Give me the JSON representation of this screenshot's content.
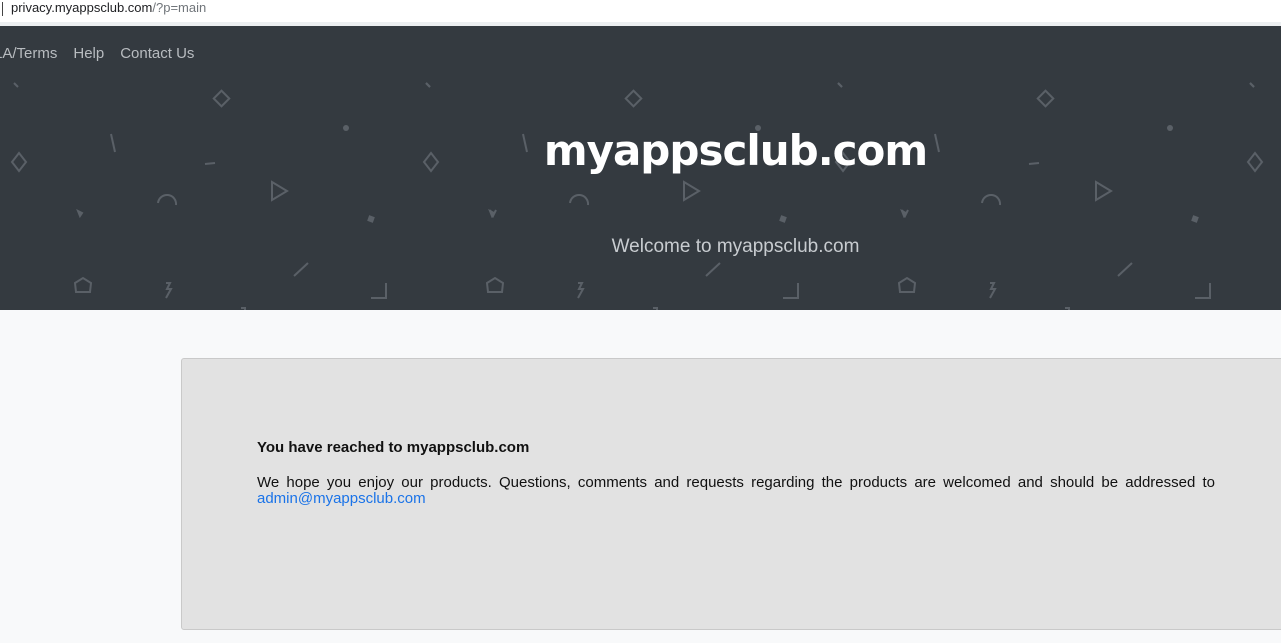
{
  "browser": {
    "url_host": "privacy.myappsclub.com",
    "url_path": "/?p=main"
  },
  "nav": {
    "items": [
      "LA/Terms",
      "Help",
      "Contact Us"
    ]
  },
  "hero": {
    "title": "myappsclub.com",
    "subtitle": "Welcome to myappsclub.com"
  },
  "content": {
    "heading": "You have reached to myappsclub.com",
    "body": "We hope you enjoy our products. Questions, comments and requests regarding the products are welcomed and should be addressed to",
    "email": "admin@myappsclub.com"
  }
}
